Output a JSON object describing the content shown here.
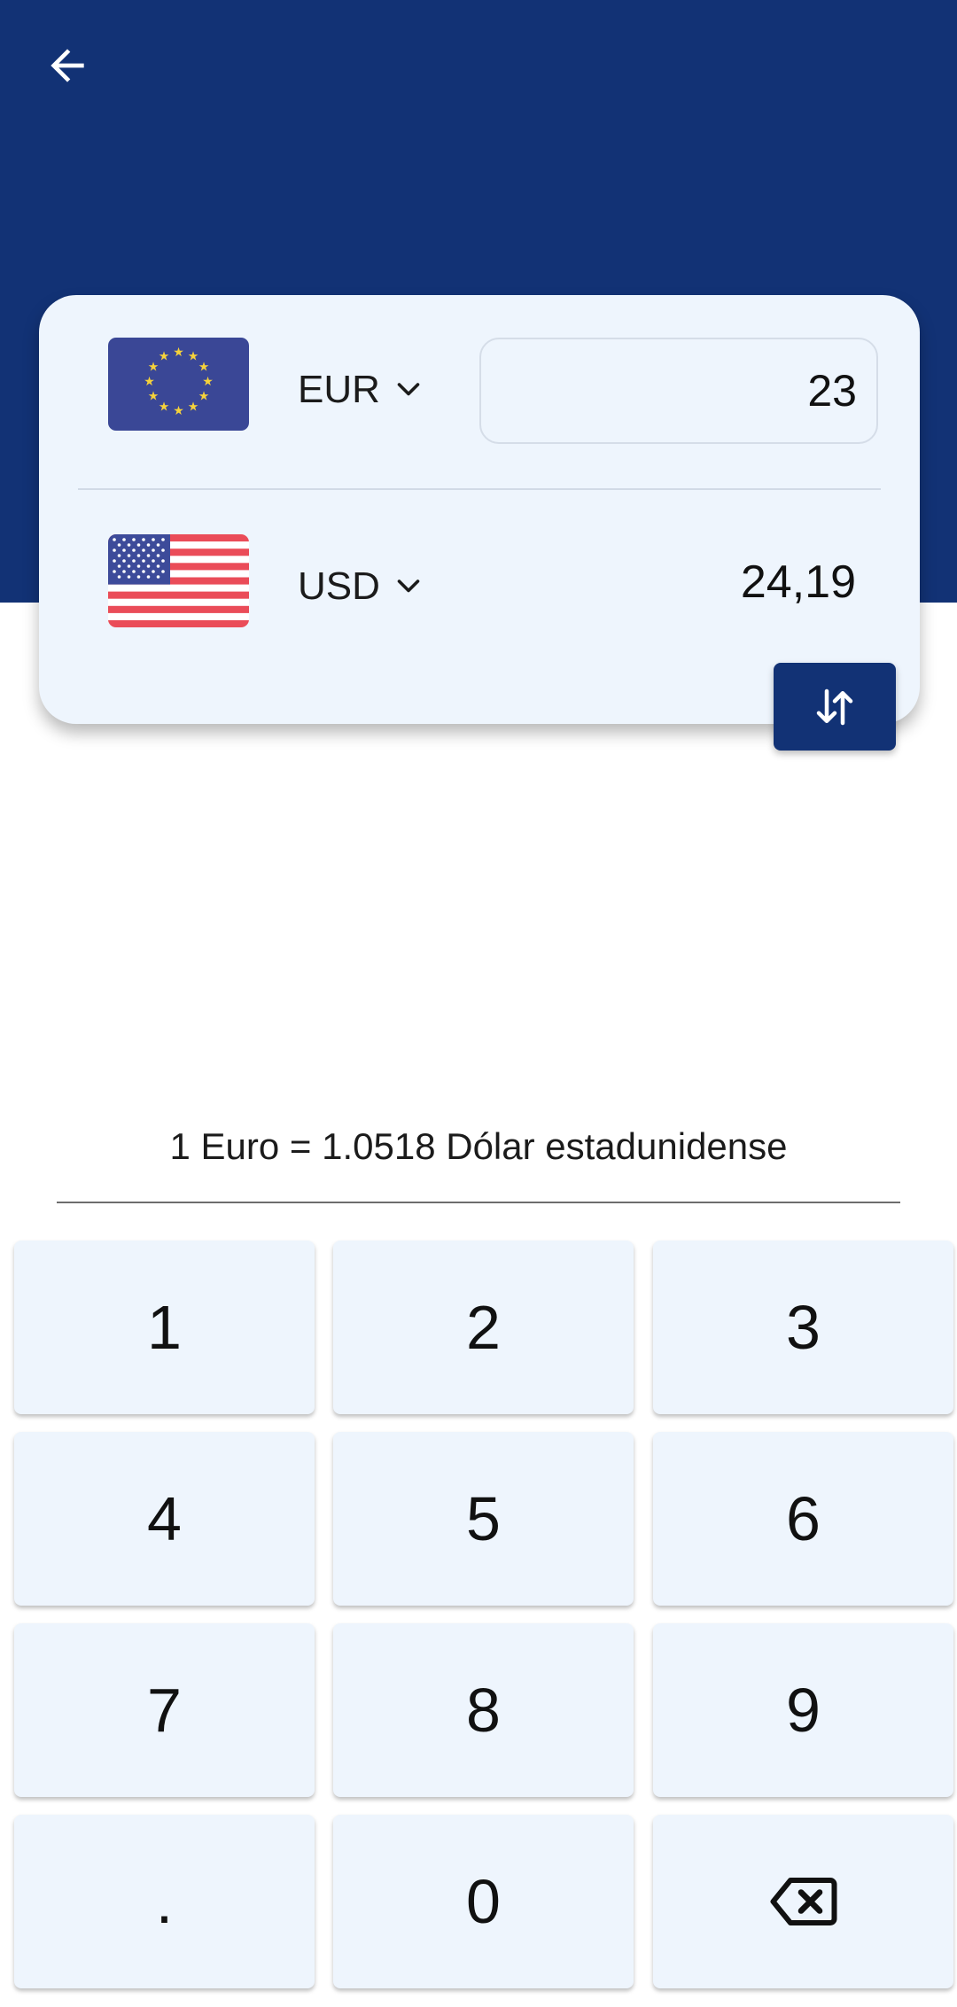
{
  "header": {
    "back_icon": "arrow-left-icon",
    "background": "#123275"
  },
  "from": {
    "flag": "eu-flag",
    "code": "EUR",
    "amount": "23"
  },
  "to": {
    "flag": "us-flag",
    "code": "USD",
    "amount": "24,19"
  },
  "swap_icon": "swap-vertical-icon",
  "rate_text": "1 Euro = 1.0518 Dólar estadunidense",
  "keypad": {
    "keys": [
      "1",
      "2",
      "3",
      "4",
      "5",
      "6",
      "7",
      "8",
      "9",
      ".",
      "0"
    ],
    "backspace_icon": "backspace-icon"
  }
}
